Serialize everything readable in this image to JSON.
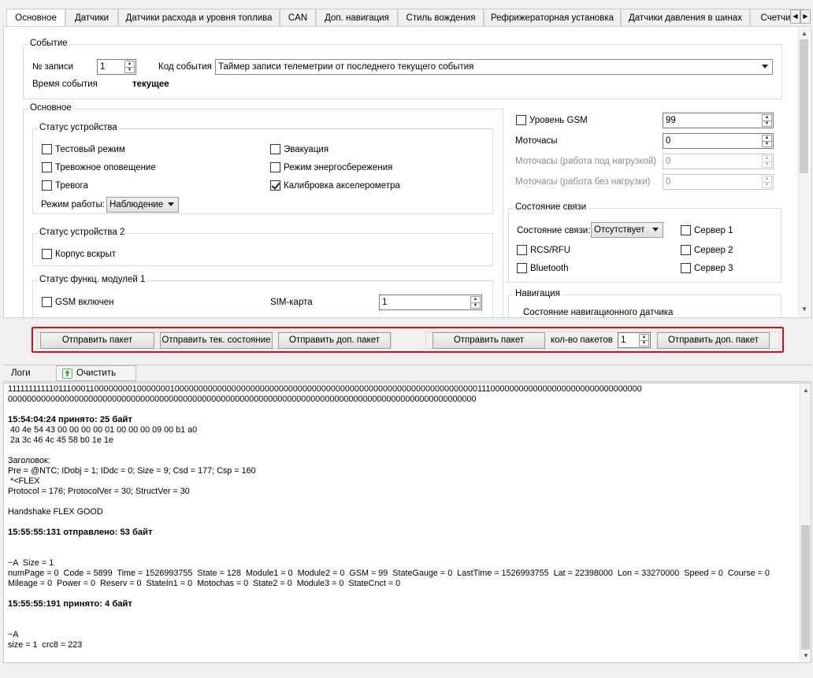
{
  "tabs": [
    "Основное",
    "Датчики",
    "Датчики расхода и уровня топлива",
    "CAN",
    "Доп. навигация",
    "Стиль вождения",
    "Рефрижераторная установка",
    "Датчики давления в шинах",
    "Счетчик"
  ],
  "event": {
    "group_title": "Событие",
    "record_no_label": "№ записи",
    "record_no_value": "1",
    "event_code_label": "Код события",
    "event_code_value": "Таймер записи телеметрии от последнего текущего события",
    "event_time_label": "Время события",
    "event_time_value": "текущее"
  },
  "main": {
    "group_title": "Основное",
    "device_status": {
      "title": "Статус устройства",
      "test_mode": "Тестовый режим",
      "alarm_notify": "Тревожное оповещение",
      "alarm": "Тревога",
      "evacuation": "Эвакуация",
      "power_save": "Режим энергосбережения",
      "accel_calib": "Калибровка акселерометра",
      "mode_label": "Режим работы:",
      "mode_value": "Наблюдение"
    },
    "device_status2": {
      "title": "Статус устройства 2",
      "case_open": "Корпус вскрыт"
    },
    "func_modules": {
      "title": "Статус функц. модулей 1",
      "gsm_on": "GSM включен",
      "sim_label": "SIM-карта",
      "sim_value": "1"
    }
  },
  "right": {
    "gsm_level_label": "Уровень GSM",
    "gsm_level_value": "99",
    "motohours_label": "Моточасы",
    "motohours_value": "0",
    "motohours_load_label": "Моточасы (работа под нагрузкой)",
    "motohours_load_value": "0",
    "motohours_noload_label": "Моточасы (работа без нагрузки)",
    "motohours_noload_value": "0",
    "conn": {
      "title": "Состояние связи",
      "state_label": "Состояние связи:",
      "state_value": "Отсутствует",
      "rcs": "RCS/RFU",
      "bluetooth": "Bluetooth",
      "server1": "Сервер 1",
      "server2": "Сервер 2",
      "server3": "Сервер 3"
    },
    "nav": {
      "title": "Навигация",
      "sub": "Состояние навигационного датчика"
    }
  },
  "actions": {
    "send_packet": "Отправить пакет",
    "send_current": "Отправить тек. состояние",
    "send_extra": "Отправить доп. пакет",
    "send_packet2": "Отправить пакет",
    "count_label": "кол-во пакетов",
    "count_value": "1",
    "send_extra2": "Отправить доп. пакет"
  },
  "logs": {
    "tab_label": "Логи",
    "clear_label": "Очистить",
    "lines": [
      "1111111111101110001100000000100000001000000000000000000000000000000000000000000000000000000000000000011100000000000000000000000000000000",
      "000000000000000000000000000000000000000000000000000000000000000000000000000000000000000000000000000",
      "",
      "15:54:04:24 принято: 25 байт",
      " 40 4e 54 43 00 00 00 00 01 00 00 00 09 00 b1 a0",
      " 2a 3c 46 4c 45 58 b0 1e 1e",
      "",
      "Заголовок:",
      "Pre = @NTC; IDobj = 1; IDdc = 0; Size = 9; Csd = 177; Csp = 160",
      " *<FLEX",
      "Protocol = 176; ProtocolVer = 30; StructVer = 30",
      "",
      "Handshake FLEX GOOD",
      "",
      "15:55:55:131 отправлено: 53 байт",
      "",
      "",
      "~A  Size = 1",
      "numPage = 0  Code = 5899  Time = 1526993755  State = 128  Module1 = 0  Module2 = 0  GSM = 99  StateGauge = 0  LastTime = 1526993755  Lat = 22398000  Lon = 33270000  Speed = 0  Course = 0",
      "Mileage = 0  Power = 0  Reserv = 0  StateIn1 = 0  Motochas = 0  State2 = 0  Module3 = 0  StateCnct = 0",
      "",
      "15:55:55:191 принято: 4 байт",
      "",
      "",
      "~A",
      "size = 1  crc8 = 223"
    ]
  },
  "colors": {
    "highlight_border": "#c8161e",
    "clear_icon": "#3a9a3a"
  }
}
